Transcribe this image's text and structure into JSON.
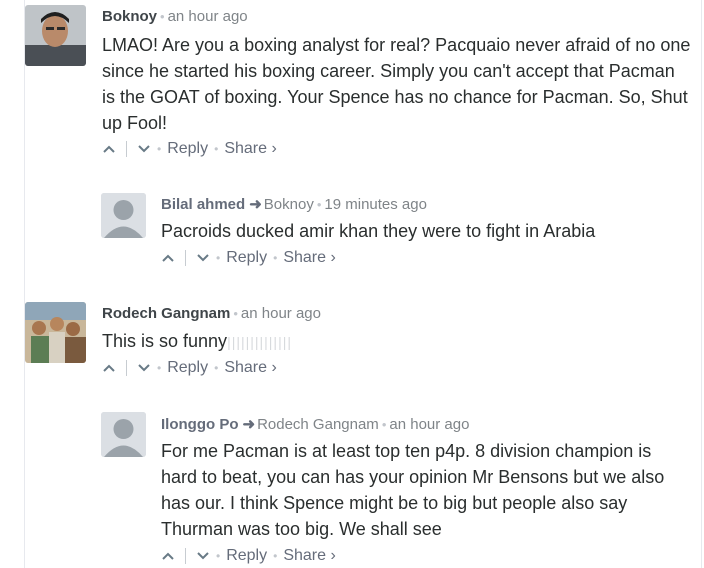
{
  "comments": [
    {
      "author": "Boknoy",
      "time": "an hour ago",
      "text": "LMAO! Are you a boxing analyst for real? Pacquaio never afraid of no one since he started his boxing career. Simply you can't accept that Pacman is the GOAT of boxing. Your Spence has no chance for Pacman. So, Shut up Fool!",
      "reply_label": "Reply",
      "share_label": "Share ›"
    },
    {
      "author": "Bilal ahmed",
      "reply_to": "Boknoy",
      "time": "19 minutes ago",
      "text": "Pacroids ducked amir khan they were to fight in Arabia",
      "reply_label": "Reply",
      "share_label": "Share ›"
    },
    {
      "author": "Rodech Gangnam",
      "time": "an hour ago",
      "text": "This is so funny",
      "garbled": "||||||||||||||",
      "reply_label": "Reply",
      "share_label": "Share ›"
    },
    {
      "author": "Ilonggo Po",
      "reply_to": "Rodech Gangnam",
      "time": "an hour ago",
      "text": "For me Pacman is at least top ten p4p. 8 division champion is hard to beat, you can has your opinion Mr Bensons but we also has our. I think Spence might be to big but people also say Thurman was too big. We shall see",
      "reply_label": "Reply",
      "share_label": "Share ›"
    }
  ],
  "icons": {
    "upvote": "chevron-up-icon",
    "downvote": "chevron-down-icon",
    "reply_arrow": "reply-arrow-icon"
  }
}
